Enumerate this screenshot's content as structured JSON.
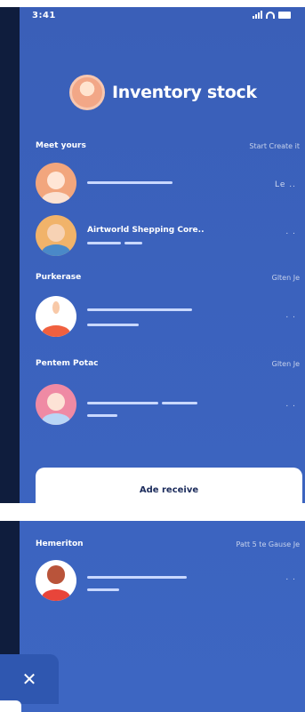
{
  "status_bar": {
    "time": "3:41",
    "icons": [
      "signal-icon",
      "wifi-icon",
      "battery-icon"
    ]
  },
  "header": {
    "title": "Inventory stock"
  },
  "sections": [
    {
      "title": "Meet yours",
      "meta": "Start Create it"
    },
    {
      "title": "Purkerase",
      "meta": "Glten Je"
    },
    {
      "title": "Pentem Potac",
      "meta": "Glten Je"
    },
    {
      "title": "Hemeriton",
      "meta": "Patt 5 te Gause Je"
    }
  ],
  "rows": [
    {
      "name": "",
      "meta": "Le .."
    },
    {
      "name": "Airtworld Shepping Core..",
      "meta": ". ."
    },
    {
      "name": "",
      "meta": ". ."
    },
    {
      "name": "",
      "meta": ". ."
    },
    {
      "name": "",
      "meta": ". ."
    }
  ],
  "add_button": {
    "label": "Ade receive"
  },
  "close_button": {
    "label": "✕"
  },
  "colors": {
    "panel": "#3b62bd",
    "dark_strip": "#0f1d3d",
    "bar": "#c9d8ff",
    "accent_text": "#1c2c5c"
  }
}
